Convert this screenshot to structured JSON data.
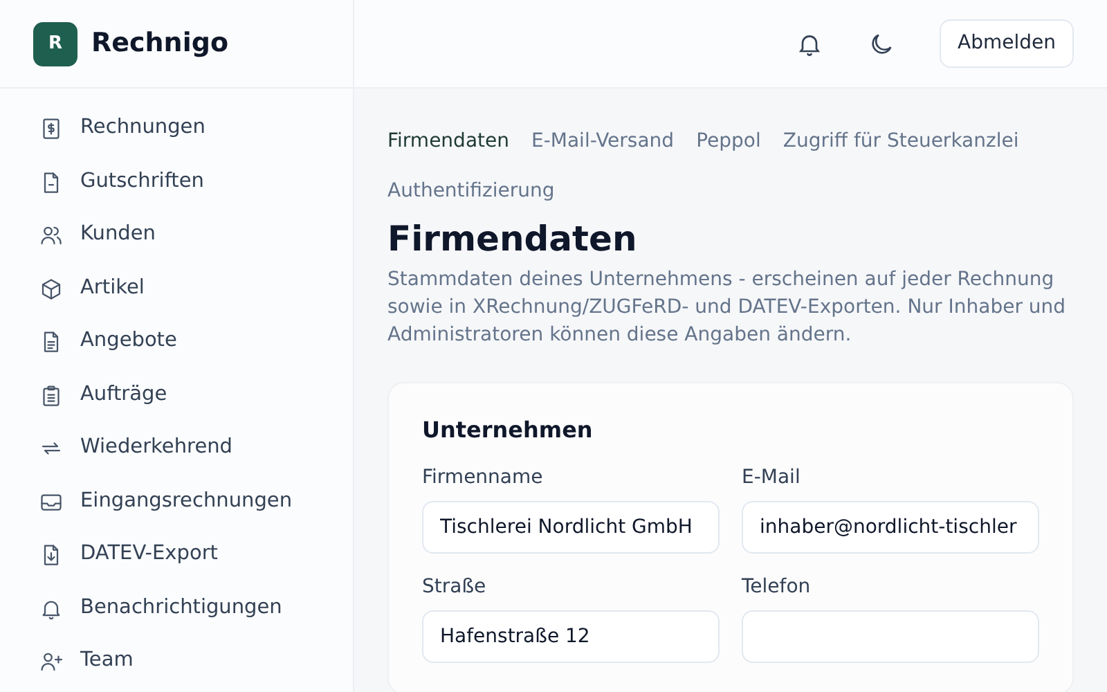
{
  "brand": {
    "logo_letter": "R",
    "name": "Rechnigo"
  },
  "sidebar": {
    "items": [
      {
        "label": "Rechnungen"
      },
      {
        "label": "Gutschriften"
      },
      {
        "label": "Kunden"
      },
      {
        "label": "Artikel"
      },
      {
        "label": "Angebote"
      },
      {
        "label": "Aufträge"
      },
      {
        "label": "Wiederkehrend"
      },
      {
        "label": "Eingangsrechnungen"
      },
      {
        "label": "DATEV-Export"
      },
      {
        "label": "Benachrichtigungen"
      },
      {
        "label": "Team"
      }
    ]
  },
  "header": {
    "logout_button": "Abmelden"
  },
  "tabs": [
    {
      "label": "Firmendaten",
      "selected": true
    },
    {
      "label": "E-Mail-Versand",
      "selected": false
    },
    {
      "label": "Peppol",
      "selected": false
    },
    {
      "label": "Zugriff für Steuerkanzlei",
      "selected": false
    },
    {
      "label": "Authentifizierung",
      "selected": false
    }
  ],
  "page": {
    "title": "Firmendaten",
    "description": "Stammdaten deines Unternehmens - erscheinen auf jeder Rechnung sowie in XRechnung/ZUGFeRD- und DATEV-Exporten. Nur Inhaber und Administratoren können diese Angaben ändern."
  },
  "section": {
    "title": "Unternehmen",
    "fields": [
      {
        "label": "Firmenname",
        "value": "Tischlerei Nordlicht GmbH"
      },
      {
        "label": "E-Mail",
        "value": "inhaber@nordlicht-tischler"
      },
      {
        "label": "Straße",
        "value": "Hafenstraße 12"
      },
      {
        "label": "Telefon"
      }
    ]
  }
}
